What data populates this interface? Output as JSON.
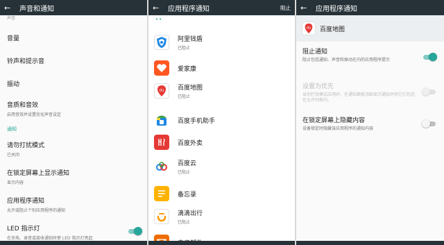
{
  "panel1": {
    "title": "声音和通知",
    "top_cut_text": "声音",
    "items": [
      {
        "title": "音量"
      },
      {
        "title": "铃声和提示音"
      },
      {
        "title": "振动"
      },
      {
        "title": "音质和音效",
        "subtitle": "启用音效并设置优化声音设定"
      }
    ],
    "section_header": "通知",
    "items2": [
      {
        "title": "请勿打扰模式",
        "subtitle": "已关闭"
      },
      {
        "title": "在锁定屏幕上显示通知",
        "subtitle": "显示内容"
      },
      {
        "title": "应用程序通知",
        "subtitle": "允许或阻止个别应用程序的通知"
      },
      {
        "title": "LED 指示灯",
        "subtitle": "在充电、录音或接收通知时使 LED 指示灯亮起",
        "toggle_on": true
      }
    ]
  },
  "panel2": {
    "title": "应用程序通知",
    "action": "阻止",
    "top_marker": "••",
    "apps": [
      {
        "name": "阿里钱盾",
        "status": "已阻止",
        "icon": "alibaba-qiandun-icon"
      },
      {
        "name": "爱家康",
        "status": "",
        "icon": "aijiakang-icon"
      },
      {
        "name": "百度地图",
        "status": "已阻止",
        "icon": "baidu-map-icon"
      },
      {
        "name": "百度手机助手",
        "status": "",
        "icon": "baidu-assistant-icon"
      },
      {
        "name": "百度外卖",
        "status": "",
        "icon": "baidu-waimai-icon"
      },
      {
        "name": "百度云",
        "status": "已阻止",
        "icon": "baidu-cloud-icon"
      },
      {
        "name": "备忘录",
        "status": "",
        "icon": "memo-icon"
      },
      {
        "name": "滴滴出行",
        "status": "已阻止",
        "icon": "didi-icon"
      },
      {
        "name": "电子邮件",
        "status": "",
        "icon": "email-icon"
      }
    ]
  },
  "panel3": {
    "title": "应用程序通知",
    "app_name": "百度地图",
    "settings": [
      {
        "title": "阻止通知",
        "subtitle": "阻止包括通知、声音和振动在内的应用程序提示",
        "toggle_on": true,
        "enabled": true
      },
      {
        "title": "设置为优先",
        "subtitle": "当勿打扰模式应用时，在通知面板顶部显示通知并将它们包括在允许列表内。",
        "toggle_on": false,
        "enabled": false
      },
      {
        "title": "在锁定屏幕上隐藏内容",
        "subtitle": "设备锁定时隐藏该应用程序的通知内容",
        "toggle_on": false,
        "enabled": true
      }
    ]
  },
  "colors": {
    "appbar": "#263238",
    "accent": "#26a69a",
    "toggle_track_on": "#80cbc4"
  }
}
